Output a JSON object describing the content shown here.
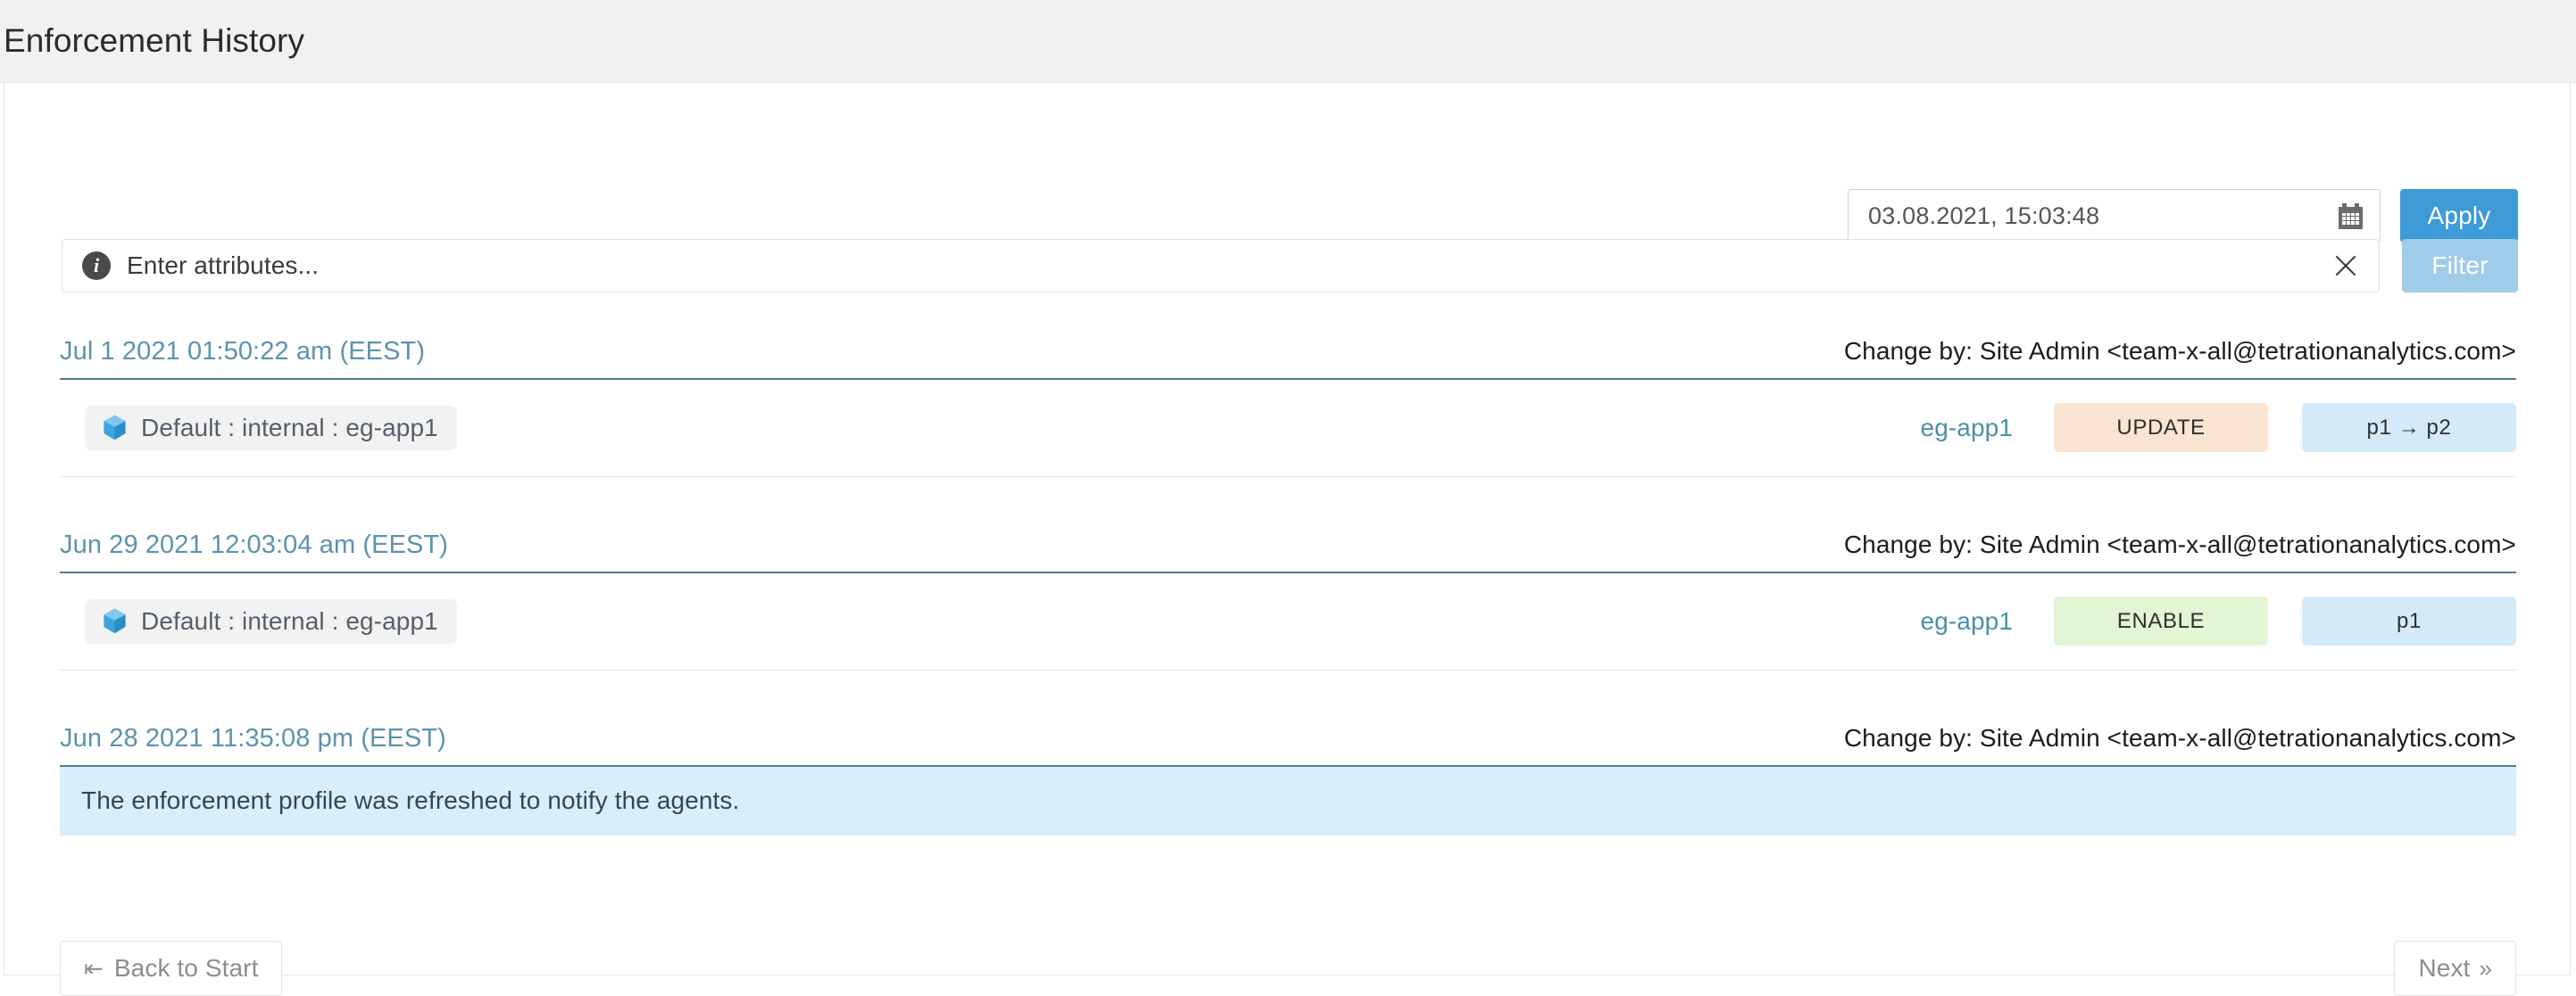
{
  "header": {
    "title": "Enforcement History"
  },
  "controls": {
    "date_value": "03.08.2021, 15:03:48",
    "calendar_icon": "calendar-icon",
    "apply_label": "Apply",
    "attributes_placeholder": "Enter attributes...",
    "info_icon": "i",
    "clear_icon": "close-icon",
    "filter_label": "Filter"
  },
  "events": [
    {
      "time": "Jul 1 2021 01:50:22 am (EEST)",
      "author": "Change by: Site Admin <team-x-all@tetrationanalytics.com>",
      "rows": [
        {
          "scope_icon": "cube-icon",
          "scope": "Default : internal : eg-app1",
          "app": "eg-app1",
          "action": "UPDATE",
          "action_kind": "update",
          "version": "p1 → p2"
        }
      ]
    },
    {
      "time": "Jun 29 2021 12:03:04 am (EEST)",
      "author": "Change by: Site Admin <team-x-all@tetrationanalytics.com>",
      "rows": [
        {
          "scope_icon": "cube-icon",
          "scope": "Default : internal : eg-app1",
          "app": "eg-app1",
          "action": "ENABLE",
          "action_kind": "enable",
          "version": "p1"
        }
      ]
    },
    {
      "time": "Jun 28 2021 11:35:08 pm (EEST)",
      "author": "Change by: Site Admin <team-x-all@tetrationanalytics.com>",
      "note": "The enforcement profile was refreshed to notify the agents."
    }
  ],
  "pager": {
    "back_label": "Back to Start",
    "back_glyph": "⇤",
    "next_label": "Next",
    "next_glyph": "»"
  },
  "colors": {
    "accent_blue": "#3f9ad8",
    "filter_disabled": "#9fcce8",
    "link_blue": "#4a90a8",
    "time_blue": "#5b93ad",
    "badge_update": "#fae5d3",
    "badge_enable": "#e2f5d4",
    "badge_version": "#d4eaf9",
    "note_bg": "#d9eefb",
    "header_bg": "#f1f1f1"
  }
}
